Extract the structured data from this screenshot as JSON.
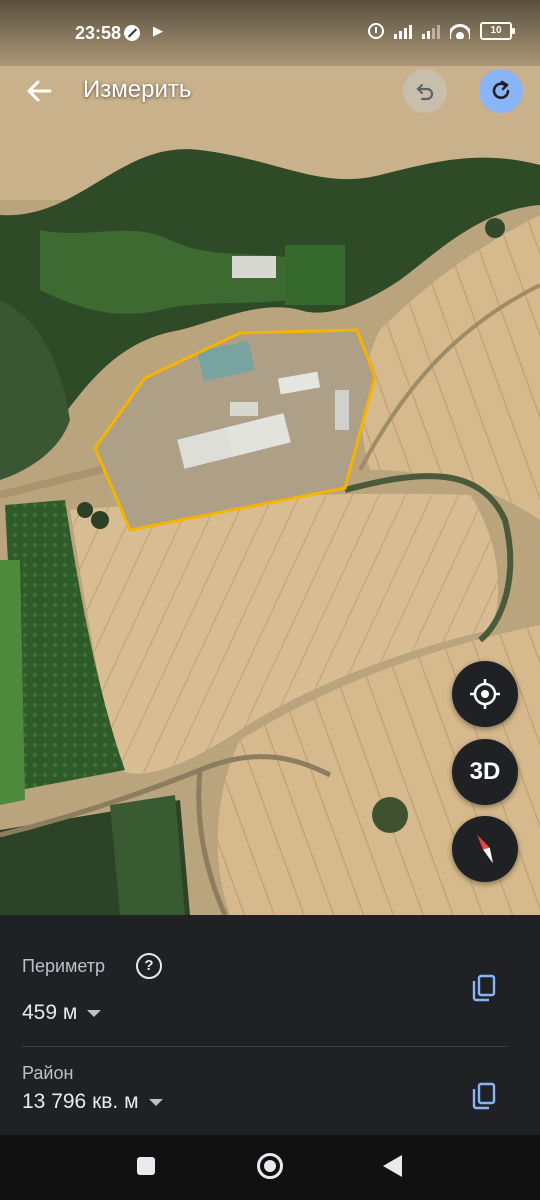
{
  "status_bar": {
    "time": "23:58",
    "battery": "10"
  },
  "header": {
    "title": "Измерить",
    "back_icon": "arrow-back-icon",
    "undo_icon": "undo-icon",
    "redo_icon": "redo-icon"
  },
  "map_controls": {
    "location_icon": "my-location-icon",
    "three_d_label": "3D",
    "compass_icon": "compass-icon"
  },
  "measurement": {
    "perimeter_label": "Периметр",
    "perimeter_value": "459 м",
    "area_label": "Район",
    "area_value": "13 796 кв. м",
    "copy_icon": "copy-icon",
    "help_icon": "help-icon"
  },
  "colors": {
    "accent": "#8ab4f8",
    "polygon": "#f4b400",
    "panel": "#202124"
  }
}
